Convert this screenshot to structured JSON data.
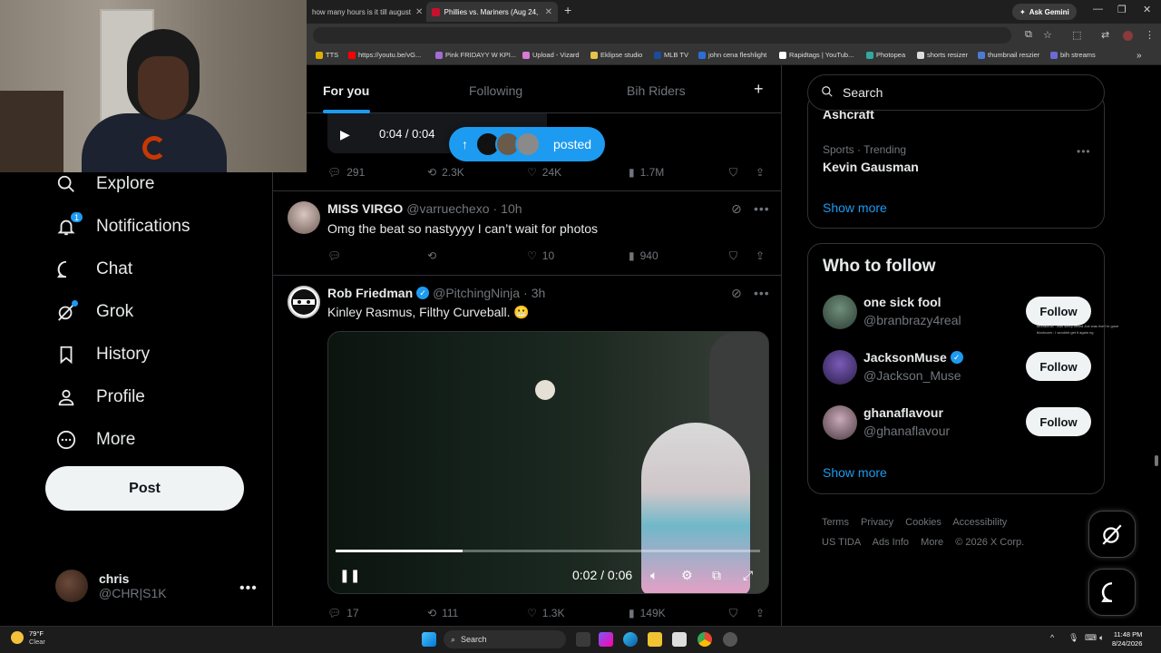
{
  "browser": {
    "tabs": [
      {
        "title": "how many hours is it till august"
      },
      {
        "title": "Phillies vs. Mariners (Aug 24, 20"
      }
    ],
    "ask_gemini": "Ask Gemini",
    "bookmarks": [
      "TTS",
      "https://youtu.be/vG...",
      "Pink FRIDAYY W KPI...",
      "Upload - Vizard",
      "Eklipse studio",
      "MLB TV",
      "john cena fleshlight",
      "Rapidtags | YouTub...",
      "Photopea",
      "shorts resizer",
      "thumbnail reszier",
      "bih streams"
    ]
  },
  "nav": {
    "items": [
      {
        "label": "Explore",
        "icon": "search-icon"
      },
      {
        "label": "Notifications",
        "icon": "bell-icon",
        "badge": "1"
      },
      {
        "label": "Chat",
        "icon": "chat-icon"
      },
      {
        "label": "Grok",
        "icon": "grok-icon"
      },
      {
        "label": "History",
        "icon": "bookmark-icon"
      },
      {
        "label": "Profile",
        "icon": "person-icon"
      },
      {
        "label": "More",
        "icon": "more-circle-icon"
      }
    ],
    "post_label": "Post",
    "account": {
      "name": "chris",
      "handle": "@CHR|S1K"
    }
  },
  "feed": {
    "tabs": [
      "For you",
      "Following",
      "Bih Riders"
    ],
    "mini_player_time": "0:04 / 0:04",
    "posted_label": "posted",
    "posts": [
      {
        "replies": "291",
        "reposts": "2.3K",
        "likes": "24K",
        "views": "1.7M"
      },
      {
        "name": "MISS VIRGO",
        "handle": "@varruechexo",
        "time": "10h",
        "text": "Omg the beat so nastyyyy I can’t wait for photos",
        "replies": "",
        "reposts": "",
        "likes": "10",
        "views": "940"
      },
      {
        "name": "Rob Friedman",
        "handle": "@PitchingNinja",
        "time": "3h",
        "text": "Kinley Rasmus, Filthy Curveball. 😬",
        "video_time": "0:02 / 0:06",
        "video_progress": 0.3,
        "replies": "17",
        "reposts": "111",
        "likes": "1.3K",
        "views": "149K"
      }
    ]
  },
  "sidebar": {
    "search_placeholder": "Search",
    "trend_top": "Ashcraft",
    "trend": {
      "category": "Sports · Trending",
      "name": "Kevin Gausman"
    },
    "show_more": "Show more",
    "who_to_follow_title": "Who to follow",
    "follow_label": "Follow",
    "suggestions": [
      {
        "name": "one sick fool",
        "handle": "@branbrazy4real",
        "verified": false
      },
      {
        "name": "JacksonMuse",
        "handle": "@Jackson_Muse",
        "verified": true
      },
      {
        "name": "ghanaflavour",
        "handle": "@ghanaflavour",
        "verified": false
      }
    ],
    "footer": [
      "Terms",
      "Privacy",
      "Cookies",
      "Accessibility",
      "US TIDA",
      "Ads Info",
      "More",
      "© 2026 X Corp."
    ]
  },
  "chat_overlay": [
    "Mortalbulb : was sleep heard Joe was live I'm gone",
    "blockcam : I wouldnt get it again ng"
  ],
  "taskbar": {
    "weather_temp": "79°F",
    "weather_desc": "Clear",
    "search_label": "Search",
    "time": "11:48 PM",
    "date": "8/24/2026"
  },
  "colors": {
    "accent": "#1d9bf0",
    "background": "#000000",
    "text": "#e7e9ea",
    "muted": "#71767b"
  }
}
